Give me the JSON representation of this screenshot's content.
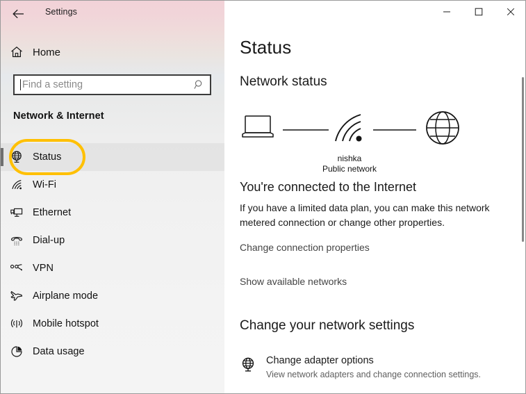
{
  "window": {
    "title": "Settings",
    "back_icon": "back-arrow-icon",
    "controls": {
      "minimize": "minimize-icon",
      "maximize": "maximize-icon",
      "close": "close-icon"
    }
  },
  "sidebar": {
    "home": {
      "label": "Home",
      "icon": "home-icon"
    },
    "search": {
      "placeholder": "Find a setting",
      "value": "",
      "icon": "search-icon"
    },
    "category_heading": "Network & Internet",
    "items": [
      {
        "label": "Status",
        "icon": "globe-stand-icon",
        "selected": true
      },
      {
        "label": "Wi-Fi",
        "icon": "wifi-icon",
        "selected": false
      },
      {
        "label": "Ethernet",
        "icon": "ethernet-icon",
        "selected": false
      },
      {
        "label": "Dial-up",
        "icon": "telephone-icon",
        "selected": false
      },
      {
        "label": "VPN",
        "icon": "vpn-icon",
        "selected": false
      },
      {
        "label": "Airplane mode",
        "icon": "airplane-icon",
        "selected": false
      },
      {
        "label": "Mobile hotspot",
        "icon": "hotspot-icon",
        "selected": false
      },
      {
        "label": "Data usage",
        "icon": "data-usage-icon",
        "selected": false
      }
    ],
    "highlight_color": "#FFC000"
  },
  "main": {
    "page_title": "Status",
    "network_status_heading": "Network status",
    "diagram": {
      "device_icon": "laptop-icon",
      "connection_icon": "wifi-icon",
      "internet_icon": "globe-icon",
      "network_name": "nishka",
      "network_type": "Public network"
    },
    "connected_heading": "You're connected to the Internet",
    "connected_description": "If you have a limited data plan, you can make this network metered connection or change other properties.",
    "links": [
      {
        "label": "Change connection properties"
      },
      {
        "label": "Show available networks"
      }
    ],
    "change_settings_heading": "Change your network settings",
    "settings_items": [
      {
        "icon": "globe-stand-icon",
        "title": "Change adapter options",
        "description": "View network adapters and change connection settings."
      }
    ]
  }
}
